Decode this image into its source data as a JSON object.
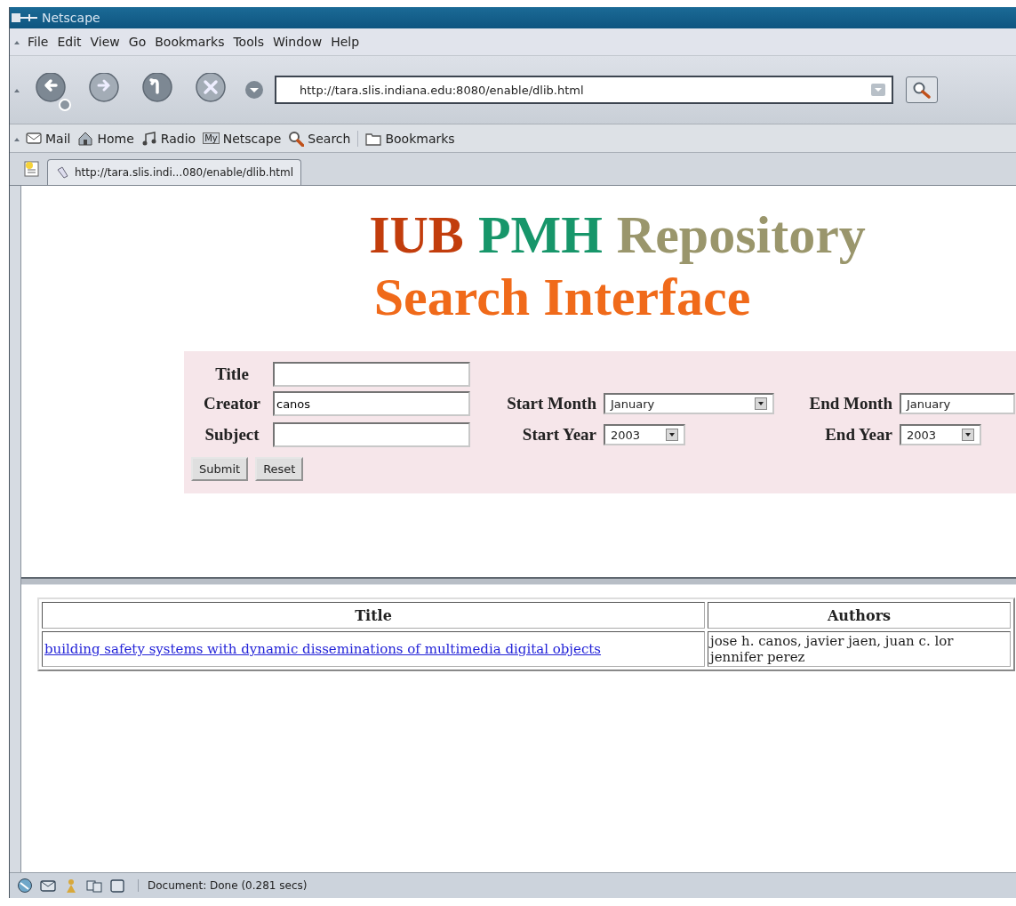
{
  "window": {
    "title": "Netscape"
  },
  "menu": [
    "File",
    "Edit",
    "View",
    "Go",
    "Bookmarks",
    "Tools",
    "Window",
    "Help"
  ],
  "navigation": {
    "buttons": [
      {
        "kind": "back",
        "disabled": false
      },
      {
        "kind": "forward",
        "disabled": true
      },
      {
        "kind": "reload",
        "disabled": false
      },
      {
        "kind": "stop",
        "disabled": true
      }
    ],
    "url": "http://tara.slis.indiana.edu:8080/enable/dlib.html"
  },
  "personal_toolbar": [
    {
      "kind": "mail",
      "label": "Mail"
    },
    {
      "kind": "home",
      "label": "Home"
    },
    {
      "kind": "radio",
      "label": "Radio"
    },
    {
      "kind": "my",
      "icon_text": "My",
      "label": "Netscape"
    },
    {
      "kind": "search",
      "label": "Search"
    },
    {
      "kind": "bookmarks",
      "label": "Bookmarks"
    }
  ],
  "tabs": [
    {
      "label": "http://tara.slis.indi...080/enable/dlib.html",
      "selected": true
    }
  ],
  "page": {
    "heading": [
      {
        "text": "IUB",
        "color": "#c23d0c"
      },
      {
        "text": "PMH",
        "color": "#17966a"
      },
      {
        "text": "Repository",
        "color": "#9a966c"
      }
    ],
    "subheading": "Search Interface",
    "form": {
      "text_fields": [
        {
          "label": "Title"
        },
        {
          "label": "Creator",
          "value": "canos"
        },
        {
          "label": "Subject"
        }
      ],
      "selects": [
        {
          "label": "Start Month",
          "value": "January"
        },
        {
          "label": "End Month",
          "value": "January"
        },
        {
          "label": "Start Year",
          "value": "2003"
        },
        {
          "label": "End Year",
          "value": "2003"
        }
      ],
      "buttons": [
        "Submit",
        "Reset"
      ]
    },
    "results": {
      "columns": [
        "Title",
        "Authors"
      ],
      "rows": [
        {
          "title": "building safety systems with dynamic disseminations of multimedia digital objects",
          "authors_lines": [
            "jose h. canos, javier jaen, juan c. lor",
            "jennifer perez"
          ]
        }
      ]
    }
  },
  "status_bar": {
    "text": "Document: Done (0.281 secs)"
  }
}
